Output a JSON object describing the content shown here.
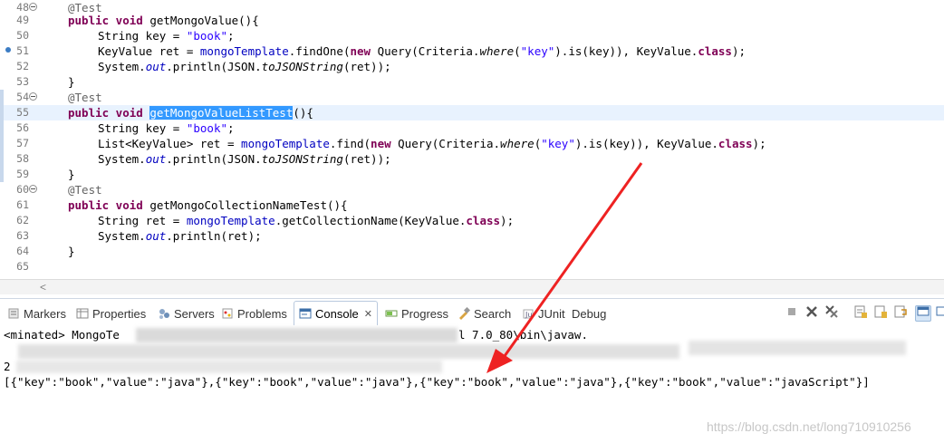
{
  "editor": {
    "lines": [
      {
        "num": "48",
        "fold": true
      },
      {
        "num": "49"
      },
      {
        "num": "50"
      },
      {
        "num": "51",
        "breakpoint": true
      },
      {
        "num": "52"
      },
      {
        "num": "53"
      },
      {
        "num": "54",
        "fold": true
      },
      {
        "num": "55",
        "current": true
      },
      {
        "num": "56"
      },
      {
        "num": "57"
      },
      {
        "num": "58"
      },
      {
        "num": "59"
      },
      {
        "num": "60",
        "fold": true
      },
      {
        "num": "61"
      },
      {
        "num": "62"
      },
      {
        "num": "63"
      },
      {
        "num": "64"
      },
      {
        "num": "65"
      }
    ],
    "code": {
      "l48_ann": "@Test",
      "l49_kw": "public void ",
      "l49_rest": "getMongoValue(){",
      "l50_a": "String key = ",
      "l50_str": "\"book\"",
      "l50_end": ";",
      "l51_a": "KeyValue ret = ",
      "l51_fld": "mongoTemplate",
      "l51_b": ".findOne(",
      "l51_kw": "new",
      "l51_c": " Query(Criteria.",
      "l51_it": "where",
      "l51_d": "(",
      "l51_str": "\"key\"",
      "l51_e": ").is(key)), KeyValue.",
      "l51_kw2": "class",
      "l51_f": ");",
      "l52_a": "System.",
      "l52_fld": "out",
      "l52_b": ".println(JSON.",
      "l52_it": "toJSONString",
      "l52_c": "(ret));",
      "l53": "}",
      "l54_ann": "@Test",
      "l55_kw": "public void ",
      "l55_sel": "getMongoValueListTest",
      "l55_rest": "(){",
      "l56_a": "String key = ",
      "l56_str": "\"book\"",
      "l56_end": ";",
      "l57_a": "List<KeyValue> ret = ",
      "l57_fld": "mongoTemplate",
      "l57_b": ".find(",
      "l57_kw": "new",
      "l57_c": " Query(Criteria.",
      "l57_it": "where",
      "l57_d": "(",
      "l57_str": "\"key\"",
      "l57_e": ").is(key)), KeyValue.",
      "l57_kw2": "class",
      "l57_f": ");",
      "l58_a": "System.",
      "l58_fld": "out",
      "l58_b": ".println(JSON.",
      "l58_it": "toJSONString",
      "l58_c": "(ret));",
      "l59": "}",
      "l60_ann": "@Test",
      "l61_kw": "public void ",
      "l61_rest": "getMongoCollectionNameTest(){",
      "l62_a": "String ret = ",
      "l62_fld": "mongoTemplate",
      "l62_b": ".getCollectionName(KeyValue.",
      "l62_kw": "class",
      "l62_c": ");",
      "l63_a": "System.",
      "l63_fld": "out",
      "l63_b": ".println(ret);",
      "l64": "}"
    },
    "scroll_left_arrow": "<"
  },
  "views": {
    "tabs": [
      {
        "label": "Markers",
        "icon": "markers-icon"
      },
      {
        "label": "Properties",
        "icon": "properties-icon"
      },
      {
        "label": "Servers",
        "icon": "servers-icon"
      },
      {
        "label": "Problems",
        "icon": "problems-icon"
      },
      {
        "label": "Console",
        "icon": "console-icon",
        "active": true
      },
      {
        "label": "Progress",
        "icon": "progress-icon"
      },
      {
        "label": "Search",
        "icon": "search-icon"
      },
      {
        "label": "JUnit",
        "icon": "junit-icon"
      },
      {
        "label": "Debug",
        "icon": "debug-icon"
      }
    ],
    "close_glyph": "✕",
    "toolbar_icons": [
      "terminate-icon",
      "remove-launch-icon",
      "remove-all-launches-icon",
      "clear-console-icon",
      "scroll-lock-icon",
      "word-wrap-icon",
      "pin-console-icon",
      "display-console-icon"
    ]
  },
  "console": {
    "header_prefix": "<",
    "header_left": "minated> MongoTe",
    "header_right": "l 7.0_80\\bin\\javaw.",
    "line2_prefix": "2",
    "output": "[{\"key\":\"book\",\"value\":\"java\"},{\"key\":\"book\",\"value\":\"java\"},{\"key\":\"book\",\"value\":\"java\"},{\"key\":\"book\",\"value\":\"javaScript\"}]"
  },
  "watermark": "https://blog.csdn.net/long710910256",
  "colors": {
    "annotation_arrow": "#ee2222",
    "keyword": "#7f0055",
    "string": "#2a00ff",
    "field": "#0000c0",
    "selection": "#3399ff"
  }
}
